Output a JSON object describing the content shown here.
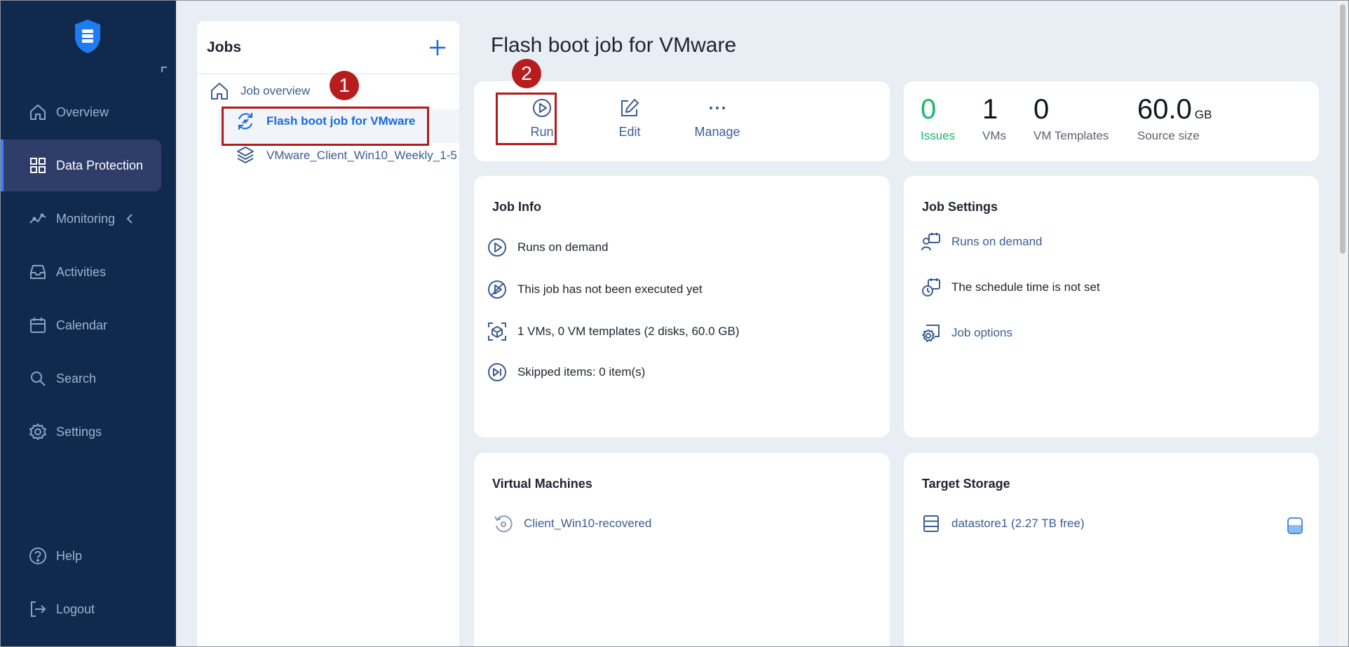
{
  "sidebar": {
    "items": [
      {
        "label": "Overview",
        "icon": "home-icon"
      },
      {
        "label": "Data Protection",
        "icon": "grid-icon",
        "active": true
      },
      {
        "label": "Monitoring",
        "icon": "chart-line-icon"
      },
      {
        "label": "Activities",
        "icon": "inbox-icon"
      },
      {
        "label": "Calendar",
        "icon": "calendar-icon"
      },
      {
        "label": "Search",
        "icon": "search-icon"
      },
      {
        "label": "Settings",
        "icon": "gear-icon"
      },
      {
        "label": "Help",
        "icon": "help-icon"
      },
      {
        "label": "Logout",
        "icon": "logout-icon"
      }
    ]
  },
  "jobs": {
    "title": "Jobs",
    "overview_label": "Job overview",
    "selected_job": "Flash boot job for VMware",
    "other_job": "VMware_Client_Win10_Weekly_1-5"
  },
  "page": {
    "title": "Flash boot job for VMware"
  },
  "actions": {
    "run": "Run",
    "edit": "Edit",
    "manage": "Manage"
  },
  "stats": {
    "issues_value": "0",
    "issues_label": "Issues",
    "vms_value": "1",
    "vms_label": "VMs",
    "templates_value": "0",
    "templates_label": "VM Templates",
    "source_value": "60.0",
    "source_unit": "GB",
    "source_label": "Source size"
  },
  "job_info": {
    "title": "Job Info",
    "runs": "Runs on demand",
    "executed": "This job has not been executed yet",
    "items": "1 VMs, 0 VM templates (2 disks, 60.0 GB)",
    "skipped": "Skipped items: 0 item(s)"
  },
  "job_settings": {
    "title": "Job Settings",
    "runs": "Runs on demand",
    "schedule": "The schedule time is not set",
    "options": "Job options"
  },
  "virtual_machines": {
    "title": "Virtual Machines",
    "vm_name": "Client_Win10-recovered"
  },
  "target_storage": {
    "title": "Target Storage",
    "datastore": "datastore1 (2.27 TB free)"
  },
  "annotations": {
    "step1": "1",
    "step2": "2"
  },
  "colors": {
    "sidebar_bg": "#0f2a4d",
    "active_bg": "#2f3d6a",
    "accent_blue": "#1769e0",
    "link_blue": "#3c5d91",
    "issues_green": "#18b96a",
    "highlight_red": "#b01c1c"
  }
}
